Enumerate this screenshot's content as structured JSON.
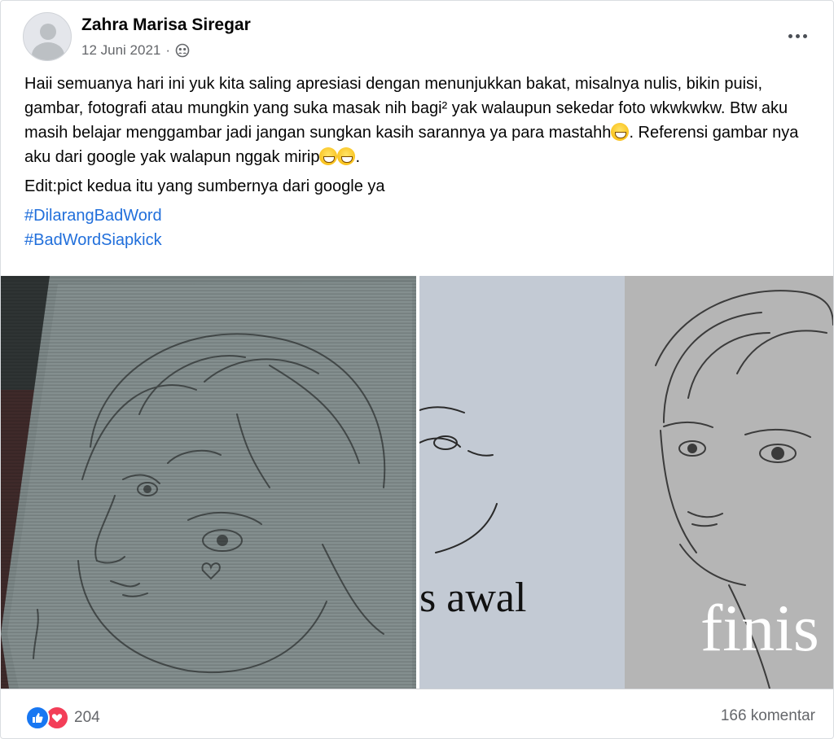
{
  "post": {
    "author": "Zahra Marisa Siregar",
    "date": "12 Juni 2021",
    "separator": "·",
    "privacy_icon": "friends-icon",
    "paragraph1_part1": "Haii semuanya hari ini yuk kita saling apresiasi dengan menunjukkan bakat, misalnya nulis, bikin puisi, gambar, fotografi atau mungkin yang suka masak nih bagi² yak walaupun sekedar foto wkwkwkw. Btw aku masih belajar menggambar jadi jangan sungkan kasih sarannya ya para mastahh",
    "paragraph1_part2": ". Referensi gambar nya aku dari google yak walapun nggak mirip",
    "paragraph1_end": ".",
    "paragraph2": "Edit:pict kedua itu yang sumbernya dari google ya",
    "hashtags": [
      "#DilarangBadWord",
      "#BadWordSiapkick"
    ]
  },
  "photos": {
    "photo2_left_caption": "s awal",
    "photo2_right_caption": "finis"
  },
  "footer": {
    "reaction_count": "204",
    "comment_count": "166 komentar"
  },
  "colors": {
    "hashtag": "#216fdb",
    "like": "#1877f2",
    "love": "#f33e58",
    "secondary_text": "#65676b"
  }
}
